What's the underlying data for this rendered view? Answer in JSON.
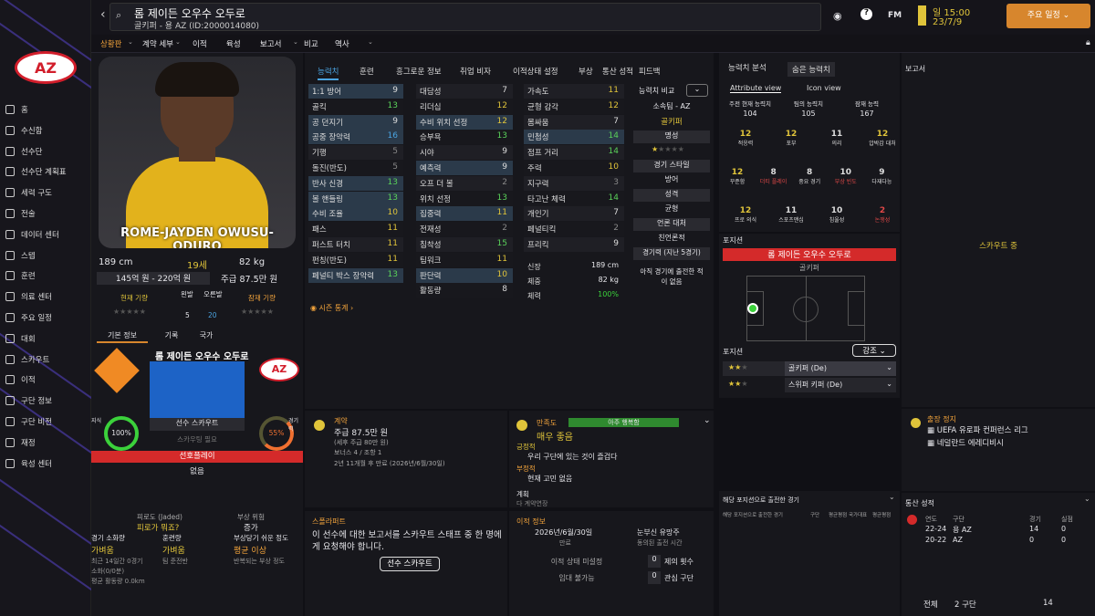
{
  "topbar": {
    "player_name": "롬 제이든 오우수 오두로",
    "player_sub": "골키퍼 - 용 AZ (ID:2000014080)",
    "time": "일 15:00",
    "date": "23/7/9",
    "continue_btn": "주요 일정",
    "fm": "FM"
  },
  "subnav": [
    "상황판",
    "계약 세부",
    "이적",
    "육성",
    "보고서",
    "비교",
    "역사"
  ],
  "sidebar": [
    "홈",
    "수신함",
    "선수단",
    "선수단 계획표",
    "세력 구도",
    "전술",
    "데이터 센터",
    "스텝",
    "훈련",
    "의료 센터",
    "주요 일정",
    "대회",
    "스카우트",
    "이적",
    "구단 정보",
    "구단 비전",
    "재정",
    "육성 센터"
  ],
  "profile": {
    "banner_name": "ROME-JAYDEN OWUSU-ODURO",
    "height": "189 cm",
    "age": "19세",
    "weight": "82 kg",
    "value": "145억 원 - 220억 원",
    "wage": "주급 87.5만 원",
    "current_ability": "현재 기량",
    "potential": "잠재 기량",
    "left_foot": "왼발",
    "right_foot": "오른발",
    "left_val": "5",
    "right_val": "20"
  },
  "info_tabs": [
    "기본 정보",
    "기록",
    "국가"
  ],
  "info": {
    "name": "롬 제이든 오우수 오두로",
    "scout_label": "선수 스카우트",
    "scout_sub": "스카우팅 필요",
    "knowledge": "지식",
    "knowledge_val": "100%",
    "familiar": "경기력",
    "familiar_val": "55%",
    "status": "선호플레이",
    "status_sub": "없음"
  },
  "condition": {
    "fatigue": "피로도 (Jaded)",
    "fatigue_sub": "피로가 뭐죠?",
    "injury": "부상 위험",
    "injury_sub": "증가",
    "c1": "경기 소화량",
    "c1v": "가벼움",
    "c2": "훈련량",
    "c2v": "가벼움",
    "c3": "부상당기 쉬운 정도",
    "c3v": "평균 이상",
    "n1": "최근 14일간 0경기",
    "n2": "소화(0/0분)",
    "n3": "평균 활동량 0.0km",
    "n4": "팀 준전반",
    "n5": "반복되는 부상 정도"
  },
  "attr_tabs": [
    "능력치",
    "훈련",
    "흥그로운 정보",
    "취업 비자",
    "이적상태 설정",
    "부상",
    "통산 성적",
    "피드백"
  ],
  "attrs": {
    "col1": [
      [
        "1:1 방어",
        "9"
      ],
      [
        "골킥",
        "13"
      ],
      [
        "공 던지기",
        "9"
      ],
      [
        "공중 장악력",
        "16"
      ],
      [
        "기행",
        "5"
      ],
      [
        "돌진(반도)",
        "5"
      ],
      [
        "반사 신경",
        "13"
      ],
      [
        "볼 핸들링",
        "13"
      ],
      [
        "수비 조율",
        "10"
      ],
      [
        "패스",
        "11"
      ],
      [
        "퍼스트 터치",
        "11"
      ],
      [
        "펀칭(반도)",
        "11"
      ],
      [
        "페널티 박스 장악력",
        "13"
      ]
    ],
    "col2": [
      [
        "대담성",
        "7"
      ],
      [
        "리더십",
        "12"
      ],
      [
        "수비 위치 선정",
        "12"
      ],
      [
        "승부욕",
        "13"
      ],
      [
        "시야",
        "9"
      ],
      [
        "예측력",
        "9"
      ],
      [
        "오프 더 볼",
        "2"
      ],
      [
        "위치 선정",
        "13"
      ],
      [
        "집중력",
        "11"
      ],
      [
        "전재성",
        "2"
      ],
      [
        "침착성",
        "15"
      ],
      [
        "팀워크",
        "11"
      ],
      [
        "판단력",
        "10"
      ],
      [
        "활동량",
        "8"
      ]
    ],
    "col3": [
      [
        "가속도",
        "11"
      ],
      [
        "균형 감각",
        "12"
      ],
      [
        "몸싸움",
        "7"
      ],
      [
        "민첩성",
        "14"
      ],
      [
        "점프 거리",
        "14"
      ],
      [
        "주력",
        "10"
      ],
      [
        "지구력",
        "3"
      ],
      [
        "타고난 체력",
        "14"
      ],
      [
        "개인기",
        "7"
      ],
      [
        "페널티킥",
        "2"
      ],
      [
        "프리킥",
        "9"
      ]
    ],
    "phys": [
      [
        "신장",
        "189 cm"
      ],
      [
        "체중",
        "82 kg"
      ],
      [
        "체력",
        "100%"
      ]
    ]
  },
  "compare": {
    "title": "능력치 비교",
    "club": "소속팀 - AZ",
    "role": "골키퍼",
    "rep": "명성",
    "style": "경기 스타일",
    "style_v": "방어",
    "personality": "성격",
    "personality_v": "균형",
    "media": "언론 대처",
    "media_v": "친언론적",
    "matches": "경기력 (지난 5경기)",
    "matches_v": "아직 경기에 출전한 적이 없음"
  },
  "season_stats": "시즌 통계",
  "contract": {
    "title": "계약",
    "wage": "주급 87.5만 원",
    "sub1": "(세후 주급 80만 원)",
    "sub2": "보너스 4 / 조항 1",
    "sub3": "2년 11개월 후 만료 (2026년/6월/30일)"
  },
  "happiness": {
    "title": "만족도",
    "badge": "아주 행복함",
    "level": "매우 좋음",
    "pos": "긍정적",
    "pos1": "우리 구단에 있는 것이 즐겁다",
    "neg": "부정적",
    "neg1": "현재 고민 없음",
    "plan": "계획",
    "plan_v": "다 계약연장"
  },
  "scout_report": {
    "title": "스폴라퍼트",
    "text": "이 선수에 대한 보고서를 스카우트 스태프 중 한 명에게 요청해야 합니다.",
    "btn": "선수 스카우트"
  },
  "transfer": {
    "title": "이적 정보",
    "expiry": "2026년/6월/30일",
    "expiry_l": "만료",
    "clause": "눈부신 유망주",
    "clause_l": "동의된 출전 시간",
    "status": "이적 상태 미설정",
    "interest": "임대 불가능",
    "offers": "0",
    "offers_l": "제의 횟수",
    "interest_v": "0",
    "interest_l": "관심 구단"
  },
  "right_tabs": [
    "능력치 분석",
    "숨은 능력치"
  ],
  "view_tabs": [
    "Attribute view",
    "Icon view"
  ],
  "ability": {
    "cur_l": "주전 현재 능력치",
    "cur": "104",
    "club_l": "팀의 능력치",
    "club": "105",
    "pot_l": "잠재 능력",
    "pot": "167"
  },
  "hidden": [
    [
      "12",
      "적응력"
    ],
    [
      "12",
      "포부"
    ],
    [
      "11",
      "의리"
    ],
    [
      "12",
      "압박감 대처"
    ],
    [
      "12",
      "꾸준함"
    ],
    [
      "8",
      "더티 플레이"
    ],
    [
      "8",
      "중요 경기"
    ],
    [
      "10",
      "부상 빈도"
    ],
    [
      "9",
      "다재다능"
    ],
    [
      "12",
      "프로 의식"
    ],
    [
      "11",
      "스포츠맨십"
    ],
    [
      "10",
      "침울성"
    ],
    [
      "2",
      "논쟁성"
    ]
  ],
  "position": {
    "title": "포지션",
    "name": "롬 제이든 오우수 오두로",
    "role": "골키퍼",
    "emph": "강조",
    "pos_title": "포지션",
    "r1": "골키퍼 (De)",
    "r2": "스위퍼 키퍼 (De)",
    "matches_title": "해당 포지션으로 출전한 경기",
    "cols": [
      "해당 포지션으로 출전한 경기",
      "구단",
      "평균평점",
      "국가대표",
      "평균평점"
    ]
  },
  "report": {
    "title": "보고서",
    "scouting": "스카우트 중"
  },
  "suspension": {
    "title": "출장 정지",
    "l1": "UEFA 유로파 컨퍼런스 리그",
    "l2": "네덜란드 에레디비시"
  },
  "career": {
    "title": "통산 성적",
    "cols": [
      "연도",
      "구단",
      "경기",
      "실점"
    ],
    "rows": [
      [
        "22-24",
        "용 AZ",
        "14",
        "0"
      ],
      [
        "20-22",
        "AZ",
        "0",
        "0"
      ]
    ],
    "total": "전체",
    "total_team": "2 구단",
    "total_games": "14"
  }
}
